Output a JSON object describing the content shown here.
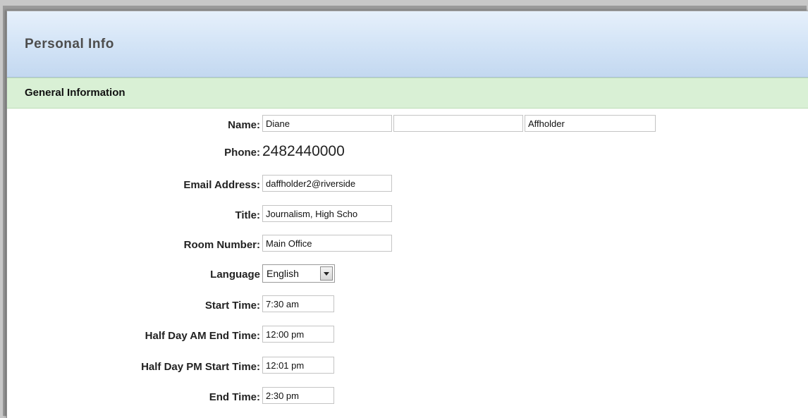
{
  "header": {
    "title": "Personal Info"
  },
  "section": {
    "title": "General Information"
  },
  "fields": {
    "name": {
      "label": "Name:",
      "first": "Diane",
      "middle": "",
      "last": "Affholder"
    },
    "phone": {
      "label": "Phone:",
      "value": "2482440000"
    },
    "email": {
      "label": "Email Address:",
      "value": "daffholder2@riverside"
    },
    "title": {
      "label": "Title:",
      "value": "Journalism, High Scho"
    },
    "room": {
      "label": "Room Number:",
      "value": "Main Office"
    },
    "language": {
      "label": "Language",
      "value": "English"
    },
    "start_time": {
      "label": "Start Time:",
      "value": "7:30 am"
    },
    "half_am_end": {
      "label": "Half Day AM End Time:",
      "value": "12:00 pm"
    },
    "half_pm_start": {
      "label": "Half Day PM Start Time:",
      "value": "12:01 pm"
    },
    "end_time": {
      "label": "End Time:",
      "value": "2:30 pm"
    }
  },
  "icons": {
    "language_dropdown": "chevron-down-icon"
  }
}
